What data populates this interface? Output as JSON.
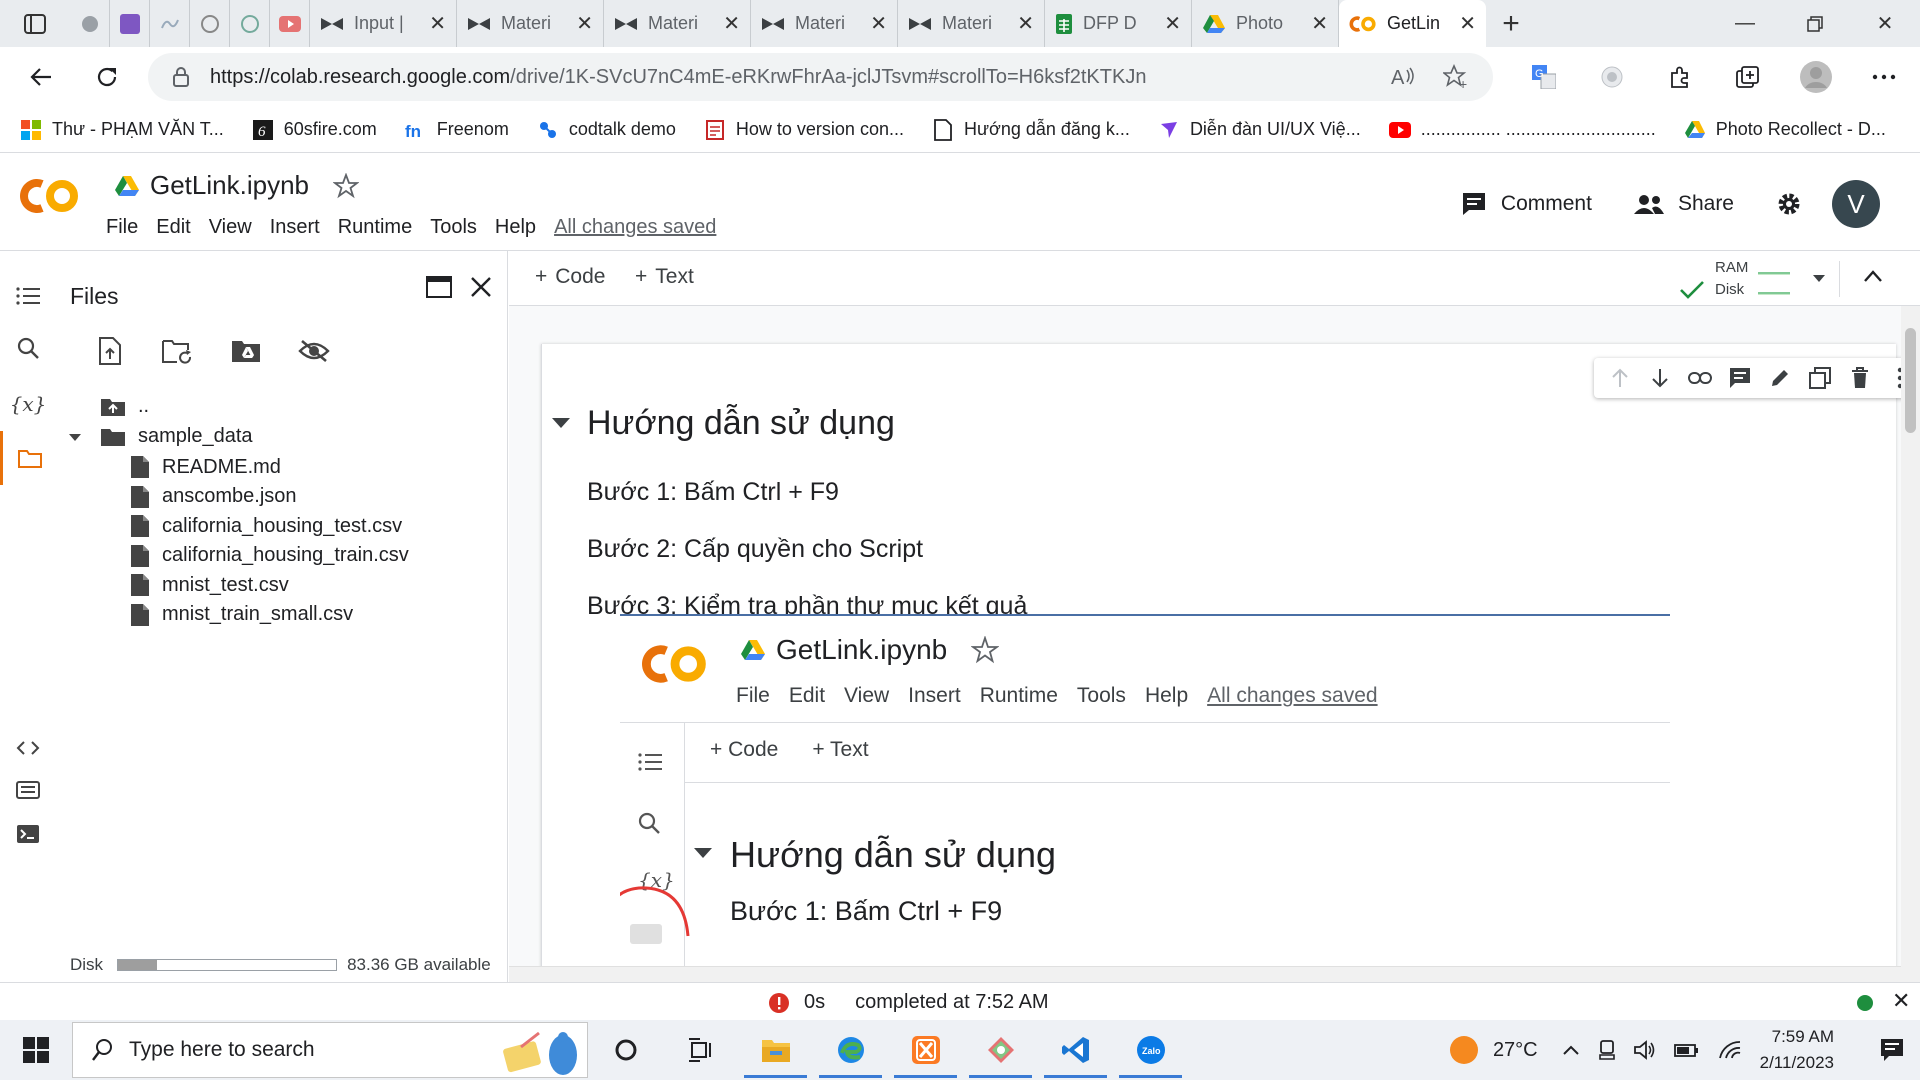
{
  "browser": {
    "tabs": [
      {
        "title": "Input |",
        "icon": "material-icon"
      },
      {
        "title": "Materi",
        "icon": "material-icon"
      },
      {
        "title": "Materi",
        "icon": "material-icon"
      },
      {
        "title": "Materi",
        "icon": "material-icon"
      },
      {
        "title": "Materi",
        "icon": "material-icon"
      },
      {
        "title": "DFP D",
        "icon": "sheets-icon"
      },
      {
        "title": "Photo",
        "icon": "drive-icon"
      },
      {
        "title": "GetLin",
        "icon": "colab-icon",
        "active": true
      }
    ],
    "url_host": "https://colab.research.google.com",
    "url_path": "/drive/1K-SVcU7nC4mE-eRKrwFhrAa-jclJTsvm#scrollTo=H6ksf2tKTKJn",
    "bookmarks": [
      {
        "label": "Thư - PHẠM VĂN T...",
        "icon": "microsoft-icon"
      },
      {
        "label": "60sfire.com",
        "icon": "sixty-icon"
      },
      {
        "label": "Freenom",
        "icon": "freenom-icon"
      },
      {
        "label": "codtalk demo",
        "icon": "codtalk-icon"
      },
      {
        "label": "How to version con...",
        "icon": "doc-red-icon"
      },
      {
        "label": "Hướng dẫn đăng k...",
        "icon": "page-icon"
      },
      {
        "label": "Diễn đàn UI/UX Việ...",
        "icon": "figma-bird-icon"
      },
      {
        "label": "................ ..............................",
        "icon": "youtube-icon"
      },
      {
        "label": "Photo Recollect - D...",
        "icon": "drive-icon"
      }
    ]
  },
  "colab": {
    "notebook_title": "GetLink.ipynb",
    "menu": [
      "File",
      "Edit",
      "View",
      "Insert",
      "Runtime",
      "Tools",
      "Help"
    ],
    "save_status": "All changes saved",
    "comment_label": "Comment",
    "share_label": "Share",
    "avatar_letter": "V",
    "add_code": "Code",
    "add_text": "Text",
    "ram_label": "RAM",
    "disk_label": "Disk"
  },
  "files_panel": {
    "title": "Files",
    "parent": "..",
    "folder": "sample_data",
    "files": [
      "README.md",
      "anscombe.json",
      "california_housing_test.csv",
      "california_housing_train.csv",
      "mnist_test.csv",
      "mnist_train_small.csv"
    ],
    "disk_label": "Disk",
    "disk_available": "83.36 GB available",
    "disk_used_fraction": 0.18
  },
  "cell": {
    "heading": "Hướng dẫn sử dụng",
    "steps": [
      "Bước 1: Bấm Ctrl + F9",
      "Bước 2: Cấp quyền cho Script",
      "Bước 3: Kiểm tra phần thư mục kết quả"
    ]
  },
  "embedded": {
    "title": "GetLink.ipynb",
    "menu": [
      "File",
      "Edit",
      "View",
      "Insert",
      "Runtime",
      "Tools",
      "Help"
    ],
    "save_status": "All changes saved",
    "add_code": "Code",
    "add_text": "Text",
    "heading": "Hướng dẫn sử dụng",
    "step1": "Bước 1: Bấm Ctrl + F9",
    "annotation_color": "#e53935"
  },
  "status": {
    "duration": "0s",
    "completed": "completed at 7:52 AM"
  },
  "taskbar": {
    "search_placeholder": "Type here to search",
    "temperature": "27°C",
    "time": "7:59 AM",
    "date": "2/11/2023"
  },
  "colors": {
    "colab_orange": "#f9ab00",
    "accent_orange": "#e8710a",
    "check_green": "#1e8e3e"
  }
}
